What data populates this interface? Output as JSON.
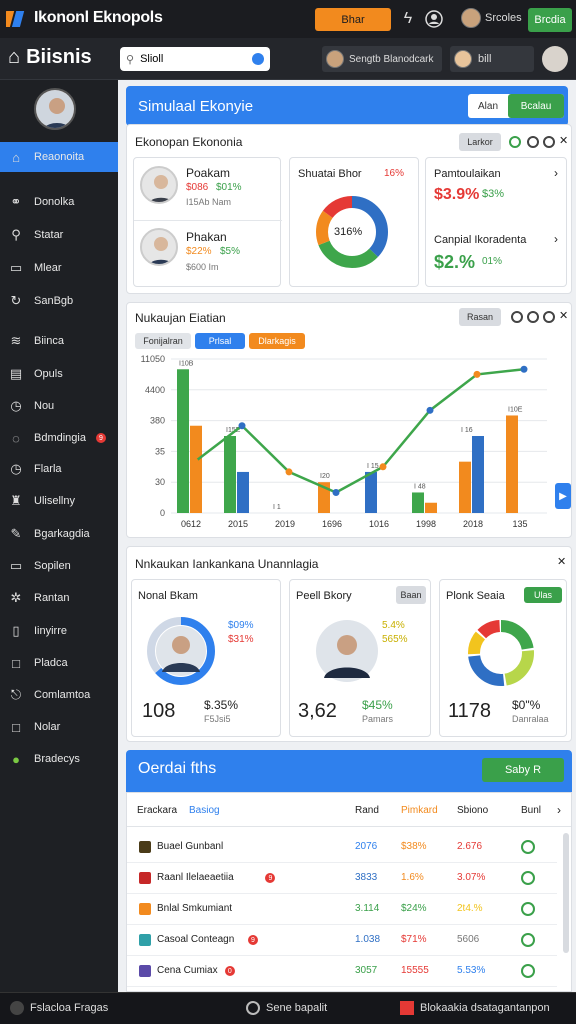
{
  "topbar": {
    "brand": "Ikononl Eknopols",
    "orange_button": "Bhar",
    "user_label": "Srcoles",
    "green_button": "Brcdia"
  },
  "secbar": {
    "title": "Biisnis",
    "search_value": "Slioll",
    "account1": "Sengtb Blanodcark",
    "account2": "bill"
  },
  "sidebar": {
    "items": [
      {
        "label": "Reaonoita",
        "icon": "home-icon",
        "active": true
      },
      {
        "label": "Donolka",
        "icon": "network-icon"
      },
      {
        "label": "Statar",
        "icon": "search-icon"
      },
      {
        "label": "Mlear",
        "icon": "window-icon"
      },
      {
        "label": "SanBgb",
        "icon": "refresh-icon"
      },
      {
        "label": "Biinca",
        "icon": "layers-icon"
      },
      {
        "label": "Opuls",
        "icon": "document-icon"
      },
      {
        "label": "Nou",
        "icon": "clock-icon"
      },
      {
        "label": "Bdmdingia",
        "icon": "chat-icon",
        "badge": "9"
      },
      {
        "label": "Flarla",
        "icon": "clock-icon"
      },
      {
        "label": "Ulisellny",
        "icon": "bag-icon"
      },
      {
        "label": "Bgarkagdia",
        "icon": "pencil-icon"
      },
      {
        "label": "Sopilen",
        "icon": "screen-icon"
      },
      {
        "label": "Rantan",
        "icon": "gear-icon"
      },
      {
        "label": "Iinyirre",
        "icon": "box-icon"
      },
      {
        "label": "Pladca",
        "icon": "square-icon"
      },
      {
        "label": "Comlamtoa",
        "icon": "exit-icon"
      },
      {
        "label": "Nolar",
        "icon": "square-icon"
      },
      {
        "label": "Bradecys",
        "icon": "green-dot-icon"
      }
    ]
  },
  "simulation": {
    "title": "Simulaal Ekonyie",
    "toggle_left": "Alan",
    "toggle_right": "Bcalau"
  },
  "economy_card": {
    "title": "Ekonopan Ekononia",
    "pill": "Larkor",
    "person1": {
      "name": "Poakam",
      "change_red": "$086",
      "change_green": "$01%",
      "sub": "I15Ab Nam"
    },
    "person2": {
      "name": "Phakan",
      "change_red": "$22%",
      "change_green": "$5%",
      "sub": "$600 Im"
    },
    "donut_card": {
      "title": "Shuatai Bhor",
      "value_red": "16%",
      "center": "316%"
    },
    "right_card": {
      "title1": "Pamtoulaikan",
      "red": "$3.9%",
      "green": "$3%",
      "title2": "Canpial Ikoradenta",
      "green_big": "$2.%",
      "green_small": "01%"
    }
  },
  "chart_card": {
    "title": "Nukaujan Eiatian",
    "pill": "Rasan",
    "legend": [
      "Fonijalran",
      "Prlsal",
      "Dlarkagis"
    ],
    "colors": {
      "green": "#3ea64b",
      "orange": "#f28a1e",
      "blue": "#2f6fc4",
      "red": "#e53935"
    }
  },
  "chart_data": {
    "type": "bar",
    "categories": [
      "0612",
      "2015",
      "2019",
      "1696",
      "1016",
      "1998",
      "2018",
      "135"
    ],
    "yticks": [
      "0",
      "30",
      "35",
      "380",
      "4400",
      "11050"
    ],
    "series": [
      {
        "name": "Fonijalran",
        "values": [
          280,
          150,
          0,
          0,
          0,
          40,
          0,
          0
        ]
      },
      {
        "name": "Prlsal",
        "values": [
          170,
          0,
          0,
          60,
          0,
          20,
          100,
          190
        ]
      },
      {
        "name": "Dlarkagis",
        "values": [
          0,
          80,
          0,
          0,
          80,
          0,
          150,
          0
        ]
      }
    ],
    "bar_labels": [
      "I10B",
      "I15E",
      "I 1",
      "I20",
      "I 15",
      "I 48",
      "I 16",
      "I10E"
    ],
    "line_values": [
      100,
      170,
      80,
      40,
      90,
      200,
      270,
      280
    ]
  },
  "region_card": {
    "title": "Nnkaukan Iankankana Unannlagia",
    "card1": {
      "title": "Nonal Bkam",
      "blue": "$09%",
      "red": "$31%",
      "value": "108",
      "money": "$.35%",
      "sub": "F5Jsi5"
    },
    "card2": {
      "title": "Peell Bkory",
      "pill": "Baan",
      "yellow1": "5.4%",
      "yellow2": "565%",
      "value": "3,62",
      "money": "$45%",
      "sub": "Pamars"
    },
    "card3": {
      "title": "Plonk Seaia",
      "pill": "Ulas",
      "value": "1178",
      "money": "$0\"%",
      "sub": "Danralaa"
    }
  },
  "table": {
    "title": "Oerdai fths",
    "button": "Saby R",
    "headers": [
      "Erackara",
      "Basiog",
      "Rand",
      "Pimkard",
      "Sbiono",
      "Bunl"
    ],
    "rows": [
      {
        "name": "Buael Gunbanl",
        "icon_color": "#4a3b18",
        "c1": "2076",
        "c2": "$38%",
        "c3": "2.676",
        "c1c": "#2f80ed",
        "c2c": "#f28a1e",
        "c3c": "#e53935"
      },
      {
        "name": "Raanl Ilelaeaetiia",
        "icon_color": "#c62828",
        "badge": "9",
        "c1": "3833",
        "c2": "1.6%",
        "c3": "3.07%",
        "c1c": "#2f6fc4",
        "c2c": "#f28a1e",
        "c3c": "#e53935"
      },
      {
        "name": "Bnlal Smkumiant",
        "icon_color": "#f28a1e",
        "c1": "3.114",
        "c2": "$24%",
        "c3": "2t4.%",
        "c1c": "#3aa04a",
        "c2c": "#3aa04a",
        "c3c": "#f2c41e"
      },
      {
        "name": "Casoal Conteagn",
        "icon_color": "#2fa0a8",
        "badge": "9",
        "c1": "1.038",
        "c2": "$71%",
        "c3": "5606",
        "c1c": "#2f6fc4",
        "c2c": "#e53935",
        "c3c": "#777777"
      },
      {
        "name": "Cena Cumiax",
        "icon_color": "#5b4aa8",
        "badge": "0",
        "c1": "3057",
        "c2": "15555",
        "c3": "5.53%",
        "c1c": "#3aa04a",
        "c2c": "#e53935",
        "c3c": "#2f80ed"
      }
    ]
  },
  "footer": {
    "left": "Fslacloa Fragas",
    "mid": "Sene bapalit",
    "right": "Blokaakia dsatagantanpon"
  }
}
